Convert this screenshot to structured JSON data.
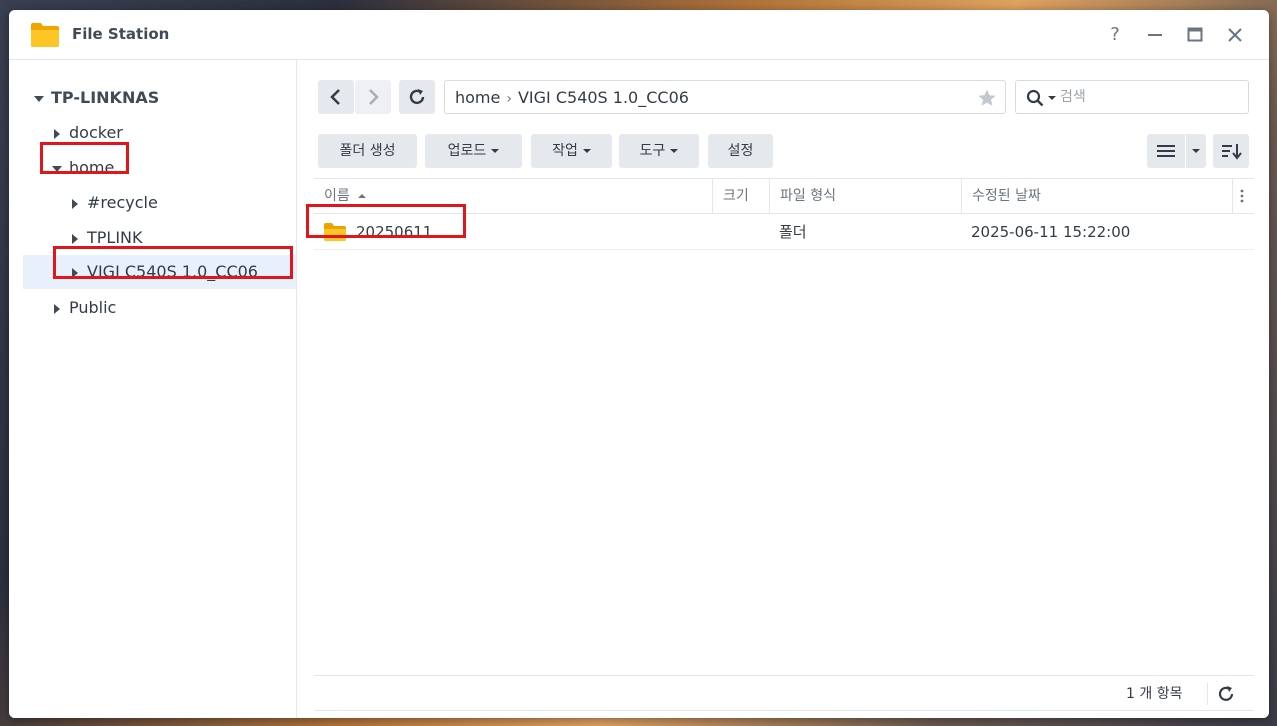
{
  "window": {
    "title": "File Station",
    "help_label": "?"
  },
  "sidebar": {
    "root": "TP-LINKNAS",
    "items": [
      {
        "label": "docker"
      },
      {
        "label": "home"
      },
      {
        "label": "#recycle"
      },
      {
        "label": "TPLINK"
      },
      {
        "label": "VIGI C540S 1.0_CC06"
      },
      {
        "label": "Public"
      }
    ]
  },
  "path": {
    "segments": [
      "home",
      "VIGI C540S 1.0_CC06"
    ],
    "separator": "›"
  },
  "search": {
    "placeholder": "검색"
  },
  "toolbar": {
    "create_folder": "폴더 생성",
    "upload": "업로드",
    "action": "작업",
    "tools": "도구",
    "settings": "설정"
  },
  "grid": {
    "columns": [
      "이름",
      "크기",
      "파일 형식",
      "수정된 날짜"
    ],
    "rows": [
      {
        "name": "20250611",
        "size": "",
        "type": "폴더",
        "modified": "2025-06-11 15:22:00"
      }
    ]
  },
  "status": {
    "count_text": "1 개 항목"
  },
  "colors": {
    "highlight": "#e0161b",
    "folder": "#f5b919",
    "selected_bg": "#e8f1fb"
  }
}
